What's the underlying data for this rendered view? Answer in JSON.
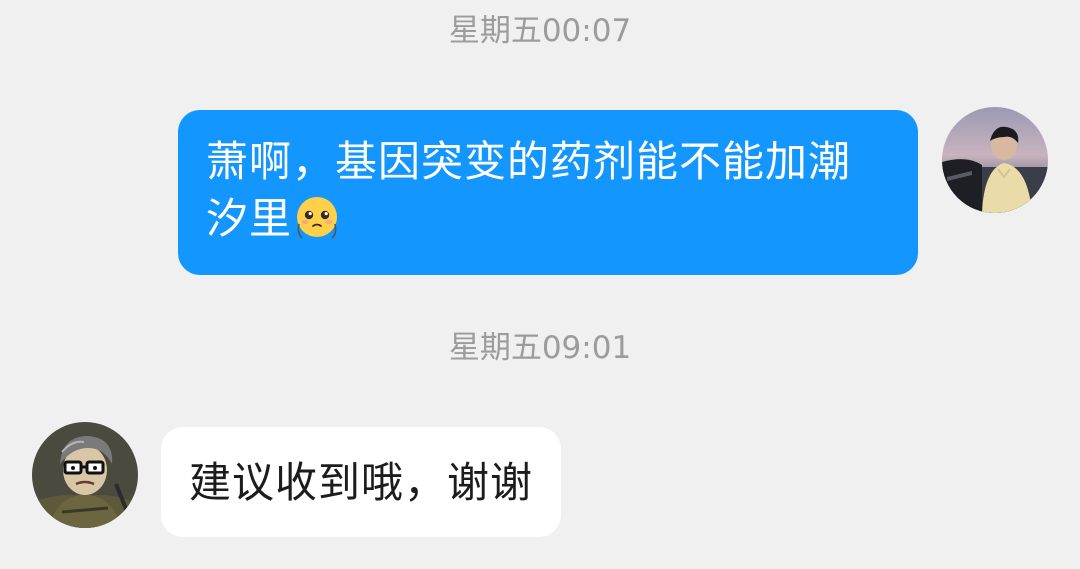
{
  "conversation": {
    "timestamp_1": "星期五00:07",
    "timestamp_2": "星期五09:01",
    "messages": [
      {
        "direction": "outgoing",
        "text": "萧啊，基因突变的药剂能不能加潮汐里",
        "emoji": "pleading-face-emoji",
        "avatar": "self-avatar"
      },
      {
        "direction": "incoming",
        "text": "建议收到哦，谢谢",
        "avatar": "other-avatar"
      }
    ]
  },
  "colors": {
    "background": "#f0f0f0",
    "outgoing_bubble": "#1496ff",
    "incoming_bubble": "#ffffff",
    "timestamp_text": "#9c9c9c"
  }
}
